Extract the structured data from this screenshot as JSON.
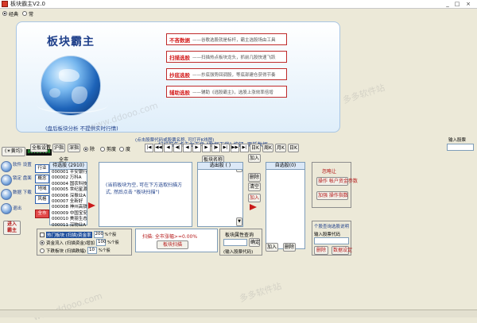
{
  "window": {
    "title": "板块霸主V2.0",
    "minimize": "_",
    "maximize": "□",
    "close": "×"
  },
  "mode": {
    "options": [
      "经典",
      "常"
    ],
    "selected": 0
  },
  "banner": {
    "title": "板块霸主",
    "caption": "(盘后板块分析 不提供实时行情)",
    "hint": "扫描前先点击左下角 \"数据下载\" 按钮, 更新数据",
    "features": [
      {
        "name": "不吝数据",
        "desc": "——谷歌选股就是标杆，霸主选股场由工具"
      },
      {
        "name": "扫描选股",
        "desc": "——扫描热点板块龙头，抓前几股快速飞跃"
      },
      {
        "name": "抄底选股",
        "desc": "——抄底强势回调股，等底部建仓获得节奏"
      },
      {
        "name": "辅助选股",
        "desc": "——辅助《逃股霸主》，选股上涨效率倍增"
      }
    ]
  },
  "left_rail": {
    "ma_button": "(☀黄均)",
    "items": [
      {
        "icon": "gear-icon",
        "label": "软件 设置"
      },
      {
        "icon": "lock-icon",
        "label": "锁定 盘面"
      },
      {
        "icon": "download-icon",
        "label": "数据 下载"
      },
      {
        "icon": "exit-icon",
        "label": "退出"
      }
    ],
    "join_button": "进入 霸主",
    "time": "09:00:00",
    "zone_buttons": [
      "行业",
      "概念",
      "地域",
      "风格",
      "全市"
    ]
  },
  "toolbar": {
    "buttons": [
      "全板设置",
      "沪指",
      "深指"
    ],
    "radios": [
      "除",
      "剪度",
      "度"
    ],
    "small_buttons": [
      "|◀",
      "◀◀",
      "◀",
      "◀|",
      "◀",
      "▶",
      "▶",
      "|▶",
      "▶|",
      "▶▶",
      "▶|"
    ],
    "query_hint": "(点击股票代码或股票名称, 可打开K线图)",
    "klines": [
      "日K",
      "周K",
      "月K",
      "日K"
    ],
    "code_input_label": "输入股票"
  },
  "pool": {
    "header": "待选股 (2910)",
    "market_label": "全市",
    "rows": [
      "000001 平安银行",
      "000002 万科A",
      "000004 国农科技",
      "000005 世纪星源",
      "000006 深振业A",
      "000007 全新好",
      "000008 神州高铁",
      "000009 中国宝安",
      "000010 美丽生态",
      "000011 深物业A"
    ]
  },
  "info_box": {
    "text": "(当前板块为空, 可在下方选取扫描方式, 然后点击 \"板块扫描\")"
  },
  "plate_panel": {
    "header": "板块名称",
    "scroll_up": "▲",
    "scroll_down": "▼"
  },
  "selected": {
    "header": "选出股 ( )",
    "mid_buttons": [
      "加入",
      "删除",
      "清空",
      "加入"
    ],
    "self_header": "自选股(0)",
    "add_label": "加入",
    "delete_label": "删除"
  },
  "right_actions": {
    "tag": "忽略让",
    "buttons": [
      "操作 帐户资金参数",
      "加强 操作指数"
    ]
  },
  "scan_options": {
    "rows": [
      {
        "label": "热门板块 (扫描)资金率",
        "val1": "200",
        "suffix": "%个股"
      },
      {
        "label": "资金流入 (扫描资金)增加",
        "val1": "100",
        "suffix": "%个股"
      },
      {
        "label": "下跌板块 (扫描跌幅)",
        "val1": "10",
        "suffix": "%个股"
      }
    ],
    "scan_result": "扫描: 全市涨幅>=0.00%",
    "scan_button": "板块扫描",
    "plate_attr_header": "板块属性查询",
    "plate_attr_input": "",
    "plate_attr_hint": "(输入股票代码)",
    "confirm": "确定"
  },
  "right_bottom": {
    "header": "个股查询选股说明",
    "input_label": "输入股票代码",
    "buttons": [
      "删除",
      "数据设定"
    ]
  },
  "watermarks": [
    "多多软件站",
    "www.ddooo.com",
    "多多软件站",
    "www.ddooo.com"
  ]
}
